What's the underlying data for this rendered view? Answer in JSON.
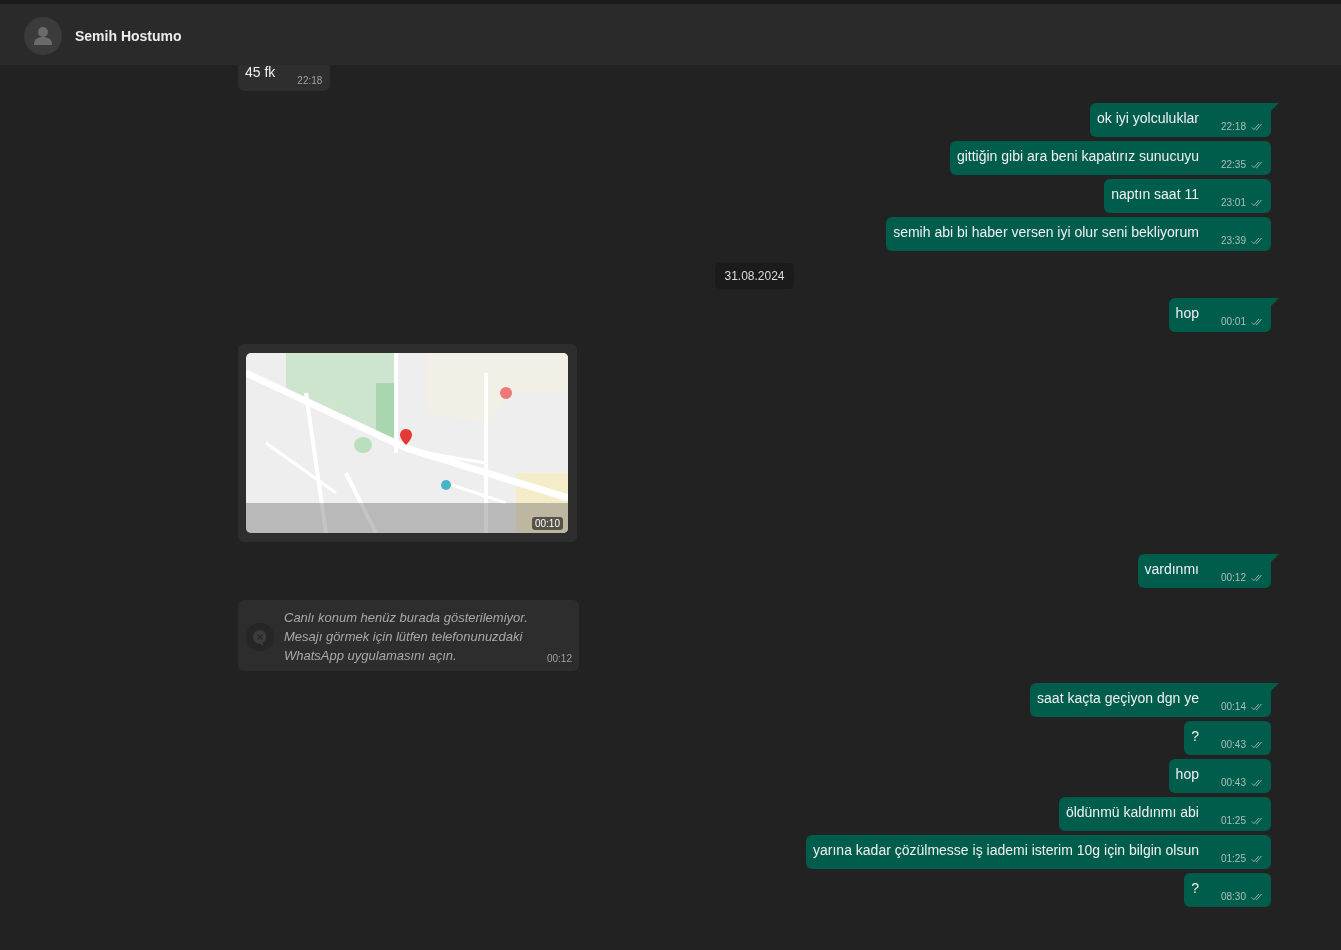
{
  "header": {
    "contact_name": "Semih Hostumo"
  },
  "messages": [
    {
      "kind": "text",
      "outgoing": false,
      "text": "45 fk",
      "time": "22:18"
    },
    {
      "kind": "text",
      "outgoing": true,
      "text": "ok iyi yolculuklar",
      "time": "22:18"
    },
    {
      "kind": "text",
      "outgoing": true,
      "text": "gittiğin gibi ara beni kapatırız sunucuyu",
      "time": "22:35"
    },
    {
      "kind": "text",
      "outgoing": true,
      "text": "naptın saat 11",
      "time": "23:01"
    },
    {
      "kind": "text",
      "outgoing": true,
      "text": "semih abi bi haber versen iyi olur seni bekliyorum",
      "time": "23:39"
    },
    {
      "kind": "date",
      "text": "31.08.2024"
    },
    {
      "kind": "text",
      "outgoing": true,
      "text": "hop",
      "time": "00:01"
    },
    {
      "kind": "location",
      "outgoing": false,
      "time": "00:10"
    },
    {
      "kind": "text",
      "outgoing": true,
      "text": "vardınmı",
      "time": "00:12"
    },
    {
      "kind": "live_location",
      "outgoing": false,
      "text": "Canlı konum henüz burada gösterilemiyor.\nMesajı görmek için lütfen telefonunuzdaki\nWhatsApp uygulamasını açın.",
      "time": "00:12"
    },
    {
      "kind": "text",
      "outgoing": true,
      "text": "saat kaçta geçiyon dgn ye",
      "time": "00:14"
    },
    {
      "kind": "text",
      "outgoing": true,
      "text": "?",
      "time": "00:43"
    },
    {
      "kind": "text",
      "outgoing": true,
      "text": "hop",
      "time": "00:43"
    },
    {
      "kind": "text",
      "outgoing": true,
      "text": "öldünmü kaldınmı abi",
      "time": "01:25"
    },
    {
      "kind": "text",
      "outgoing": true,
      "text": "yarına kadar çözülmesse iş iademi isterim 10g için bilgin olsun",
      "time": "01:25"
    },
    {
      "kind": "text",
      "outgoing": true,
      "text": "?",
      "time": "08:30"
    }
  ]
}
